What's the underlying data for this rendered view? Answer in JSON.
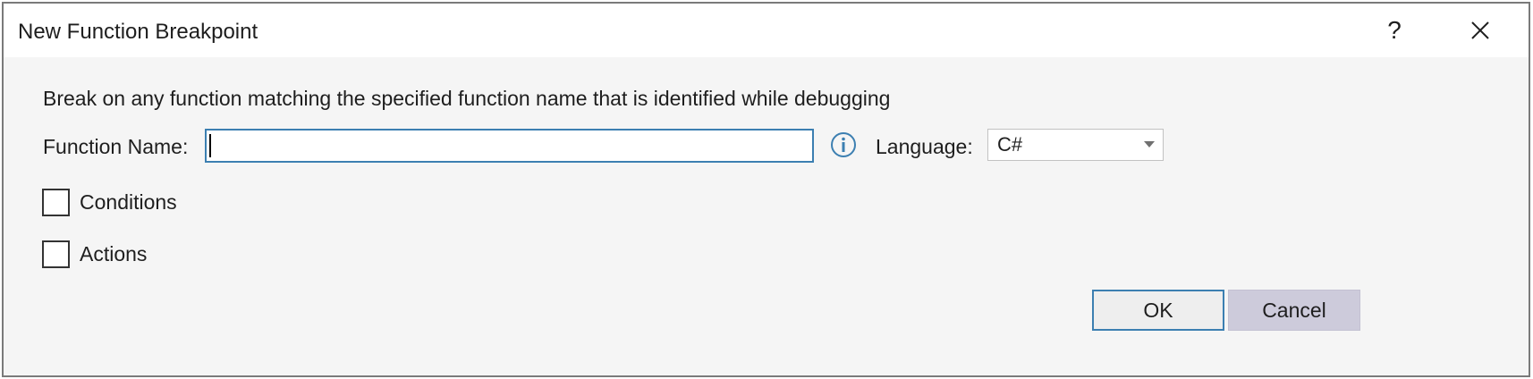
{
  "dialog": {
    "title": "New Function Breakpoint",
    "help_label": "?",
    "description": "Break on any function matching the specified function name that is identified while debugging",
    "function_name": {
      "label": "Function Name:",
      "value": ""
    },
    "language": {
      "label": "Language:",
      "selected": "C#"
    },
    "checkboxes": [
      {
        "label": "Conditions",
        "checked": false
      },
      {
        "label": "Actions",
        "checked": false
      }
    ],
    "buttons": {
      "ok_label": "OK",
      "cancel_label": "Cancel"
    },
    "icons": {
      "info": "info-icon",
      "close": "close-icon",
      "dropdown": "chevron-down-icon"
    },
    "colors": {
      "focus_border": "#3c7fb1",
      "info_icon": "#3c7fb1",
      "dialog_background": "#f5f5f5",
      "cancel_background": "#cdcbdb"
    }
  }
}
